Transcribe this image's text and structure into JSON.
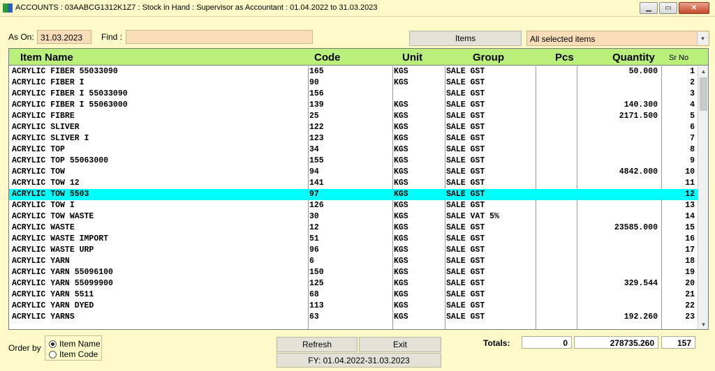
{
  "window": {
    "title": "ACCOUNTS : 03AABCG1312K1Z7 : Stock in Hand : Supervisor as Accountant : 01.04.2022 to 31.03.2023",
    "min_glyph": "▁",
    "max_glyph": "▭",
    "close_glyph": "✕"
  },
  "filters": {
    "as_on_label": "As On:",
    "as_on_value": "31.03.2023",
    "find_label": "Find :",
    "find_value": "",
    "items_button": "Items",
    "items_select_value": "All selected items",
    "dropdown_glyph": "▾"
  },
  "grid": {
    "columns": [
      "Item Name",
      "Code",
      "Unit",
      "Group",
      "Pcs",
      "Quantity",
      "Sr No"
    ],
    "selected_index": 11,
    "rows": [
      {
        "name": "ACRYLIC FIBER 55033090",
        "code": "165",
        "unit": "KGS",
        "group": "SALE GST",
        "pcs": "",
        "qty": "50.000",
        "sr": "1"
      },
      {
        "name": "ACRYLIC FIBER I",
        "code": "90",
        "unit": "KGS",
        "group": "SALE GST",
        "pcs": "",
        "qty": "",
        "sr": "2"
      },
      {
        "name": "ACRYLIC FIBER I 55033090",
        "code": "156",
        "unit": "",
        "group": "SALE GST",
        "pcs": "",
        "qty": "",
        "sr": "3"
      },
      {
        "name": "ACRYLIC FIBER I 55063000",
        "code": "139",
        "unit": "KGS",
        "group": "SALE GST",
        "pcs": "",
        "qty": "140.300",
        "sr": "4"
      },
      {
        "name": "ACRYLIC FIBRE",
        "code": "25",
        "unit": "KGS",
        "group": "SALE GST",
        "pcs": "",
        "qty": "2171.500",
        "sr": "5"
      },
      {
        "name": "ACRYLIC SLIVER",
        "code": "122",
        "unit": "KGS",
        "group": "SALE GST",
        "pcs": "",
        "qty": "",
        "sr": "6"
      },
      {
        "name": "ACRYLIC SLIVER I",
        "code": "123",
        "unit": "KGS",
        "group": "SALE GST",
        "pcs": "",
        "qty": "",
        "sr": "7"
      },
      {
        "name": "ACRYLIC TOP",
        "code": "34",
        "unit": "KGS",
        "group": "SALE GST",
        "pcs": "",
        "qty": "",
        "sr": "8"
      },
      {
        "name": "ACRYLIC TOP 55063000",
        "code": "155",
        "unit": "KGS",
        "group": "SALE GST",
        "pcs": "",
        "qty": "",
        "sr": "9"
      },
      {
        "name": "ACRYLIC TOW",
        "code": "94",
        "unit": "KGS",
        "group": "SALE GST",
        "pcs": "",
        "qty": "4842.000",
        "sr": "10"
      },
      {
        "name": "ACRYLIC TOW 12",
        "code": "141",
        "unit": "KGS",
        "group": "SALE GST",
        "pcs": "",
        "qty": "",
        "sr": "11"
      },
      {
        "name": "ACRYLIC TOW 5503",
        "code": "97",
        "unit": "KGS",
        "group": "SALE GST",
        "pcs": "",
        "qty": "",
        "sr": "12"
      },
      {
        "name": "ACRYLIC TOW I",
        "code": "126",
        "unit": "KGS",
        "group": "SALE GST",
        "pcs": "",
        "qty": "",
        "sr": "13"
      },
      {
        "name": "ACRYLIC TOW WASTE",
        "code": "30",
        "unit": "KGS",
        "group": "SALE VAT 5%",
        "pcs": "",
        "qty": "",
        "sr": "14"
      },
      {
        "name": "ACRYLIC WASTE",
        "code": "12",
        "unit": "KGS",
        "group": "SALE GST",
        "pcs": "",
        "qty": "23585.000",
        "sr": "15"
      },
      {
        "name": "ACRYLIC WASTE IMPORT",
        "code": "51",
        "unit": "KGS",
        "group": "SALE GST",
        "pcs": "",
        "qty": "",
        "sr": "16"
      },
      {
        "name": "ACRYLIC WASTE URP",
        "code": "96",
        "unit": "KGS",
        "group": "SALE GST",
        "pcs": "",
        "qty": "",
        "sr": "17"
      },
      {
        "name": "ACRYLIC YARN",
        "code": "6",
        "unit": "KGS",
        "group": "SALE GST",
        "pcs": "",
        "qty": "",
        "sr": "18"
      },
      {
        "name": "ACRYLIC YARN 55096100",
        "code": "150",
        "unit": "KGS",
        "group": "SALE GST",
        "pcs": "",
        "qty": "",
        "sr": "19"
      },
      {
        "name": "ACRYLIC YARN 55099900",
        "code": "125",
        "unit": "KGS",
        "group": "SALE GST",
        "pcs": "",
        "qty": "329.544",
        "sr": "20"
      },
      {
        "name": "ACRYLIC YARN 5511",
        "code": "68",
        "unit": "KGS",
        "group": "SALE GST",
        "pcs": "",
        "qty": "",
        "sr": "21"
      },
      {
        "name": "ACRYLIC YARN DYED",
        "code": "113",
        "unit": "KGS",
        "group": "SALE GST",
        "pcs": "",
        "qty": "",
        "sr": "22"
      },
      {
        "name": "ACRYLIC YARNS",
        "code": "63",
        "unit": "KGS",
        "group": "SALE GST",
        "pcs": "",
        "qty": "192.260",
        "sr": "23"
      }
    ],
    "scroll_up_glyph": "▲",
    "scroll_down_glyph": "▼"
  },
  "footer": {
    "order_by_label": "Order by",
    "order_options": [
      "Item Name",
      "Item Code"
    ],
    "order_selected": "Item Name",
    "refresh_label": "Refresh",
    "exit_label": "Exit",
    "fy_text": "FY: 01.04.2022-31.03.2023",
    "totals_label": "Totals:",
    "total_pcs": "0",
    "total_qty": "278735.260",
    "total_count": "157"
  },
  "colors": {
    "background": "#fdf9c8",
    "header_green": "#b8f07a",
    "selected_row": "#00ffff",
    "input_peach": "#f9dcb8"
  }
}
